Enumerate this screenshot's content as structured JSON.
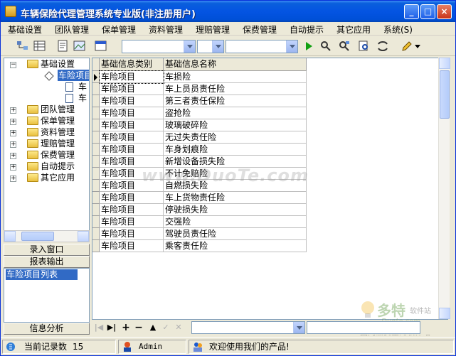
{
  "window": {
    "title": "车辆保险代理管理系统专业版(非注册用户)",
    "minimize_glyph": "_",
    "maximize_glyph": "□",
    "close_glyph": "×"
  },
  "menu": [
    "基础设置",
    "团队管理",
    "保单管理",
    "资料管理",
    "理赔管理",
    "保费管理",
    "自动提示",
    "其它应用",
    "系统(S)"
  ],
  "toolbar": {
    "icons": [
      "tree-view-icon",
      "grid-view-icon",
      "document-icon",
      "image-icon",
      "window-icon",
      "run-icon",
      "find-user-icon",
      "find-user-next-icon",
      "search-doc-icon",
      "refresh-icon",
      "edit-pencil-icon"
    ],
    "combo_1": "",
    "combo_2": "",
    "combo_3": ""
  },
  "tree": {
    "root": "基础设置",
    "selected": "车险项目",
    "children": [
      "车",
      "车"
    ],
    "nodes": [
      "团队管理",
      "保单管理",
      "资料管理",
      "理赔管理",
      "保费管理",
      "自动提示",
      "其它应用"
    ]
  },
  "outlook": {
    "buttons": [
      "录入窗口",
      "报表输出"
    ],
    "list_item": "车险项目列表",
    "bottom_button": "信息分析"
  },
  "grid": {
    "columns": [
      "基础信息类别",
      "基础信息名称"
    ],
    "rows": [
      [
        "车险项目",
        "车损险"
      ],
      [
        "车险项目",
        "车上员员责任险"
      ],
      [
        "车险项目",
        "第三者责任保险"
      ],
      [
        "车险项目",
        "盗抢险"
      ],
      [
        "车险项目",
        "玻璃破碎险"
      ],
      [
        "车险项目",
        "无过失责任险"
      ],
      [
        "车险项目",
        "车身划痕险"
      ],
      [
        "车险项目",
        "新增设备损失险"
      ],
      [
        "车险项目",
        "不计免赔险"
      ],
      [
        "车险项目",
        "自燃损失险"
      ],
      [
        "车险项目",
        "车上货物责任险"
      ],
      [
        "车险项目",
        "停驶损失险"
      ],
      [
        "车险项目",
        "交强险"
      ],
      [
        "车险项目",
        "驾驶员责任险"
      ],
      [
        "车险项目",
        "乘客责任险"
      ]
    ]
  },
  "navigator": {
    "buttons": [
      "|◀",
      "▶|",
      "+",
      "−",
      "▲",
      "✓",
      "✕"
    ],
    "combo_value": ""
  },
  "status": {
    "records_label": "当前记录数",
    "records_count": "15",
    "user": "Admin",
    "message": "欢迎使用我们的产品!"
  },
  "watermark": {
    "text": "www.DuoTe.com",
    "logo_top": "多特",
    "logo_sub": "软件站",
    "logo_url": "Duote.com",
    "logo_slogan": "国内最安全的软件站"
  },
  "colors": {
    "title_bar": "#0054e3",
    "selection": "#316ac5",
    "face": "#ece9d8"
  }
}
